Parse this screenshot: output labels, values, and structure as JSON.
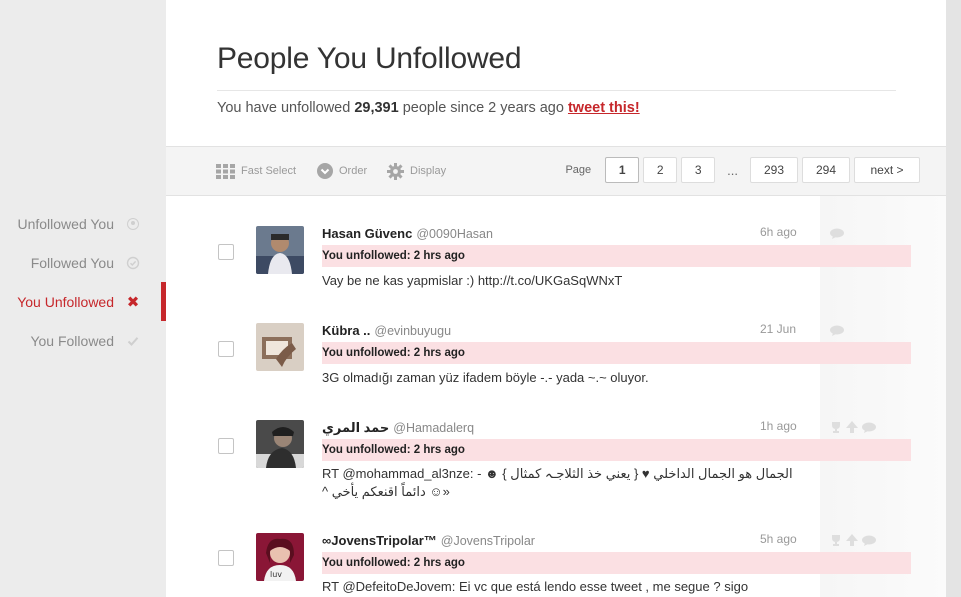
{
  "sidebar": {
    "items": [
      {
        "label": "Unfollowed You",
        "icon": "circle-dot-icon",
        "active": false
      },
      {
        "label": "Followed You",
        "icon": "circle-check-icon",
        "active": false
      },
      {
        "label": "You Unfollowed",
        "icon": "x-icon",
        "active": true
      },
      {
        "label": "You Followed",
        "icon": "check-icon",
        "active": false
      }
    ]
  },
  "header": {
    "title": "People You Unfollowed",
    "summary_prefix": "You have unfollowed ",
    "count": "29,391",
    "summary_suffix": " people since 2 years ago ",
    "tweet_link": "tweet this!"
  },
  "toolbar": {
    "fast_select": "Fast Select",
    "order": "Order",
    "display": "Display"
  },
  "pager": {
    "label": "Page",
    "pages": [
      "1",
      "2",
      "3"
    ],
    "ellipsis": "...",
    "tail_pages": [
      "293",
      "294"
    ],
    "next": "next >",
    "current": "1"
  },
  "colors": {
    "accent": "#c6272b",
    "band": "#fbe0e3"
  },
  "users": [
    {
      "name": "Hasan Güvenc",
      "handle": "@0090Hasan",
      "time": "6h ago",
      "status": "You unfollowed: 2 hrs ago",
      "tweet": "Vay be ne kas yapmislar :) http://t.co/UKGaSqWNxT",
      "tweet2": ""
    },
    {
      "name": "Kübra ..",
      "handle": "@evinbuyugu",
      "time": "21 Jun",
      "status": "You unfollowed: 2 hrs ago",
      "tweet": "3G olmadığı zaman yüz ifadem böyle -.- yada ~.~ oluyor.",
      "tweet2": ""
    },
    {
      "name": "حمد المري",
      "handle": "@Hamadalerq",
      "time": "1h ago",
      "status": "You unfollowed: 2 hrs ago",
      "tweet": "RT @mohammad_al3nze: - ☻ { يعني خذ الثلاجـہ كمثال } ♥ الجمال هو الجمال الداخلي",
      "tweet2": "^ دائماً اقنعكم يأخي ☺»"
    },
    {
      "name": "∞JovensTripolar™",
      "handle": "@JovensTripolar",
      "time": "5h ago",
      "status": "You unfollowed: 2 hrs ago",
      "tweet": "RT @DefeitoDeJovem: Ei vc que está lendo esse tweet , me segue ? sigo",
      "tweet2": ""
    }
  ]
}
